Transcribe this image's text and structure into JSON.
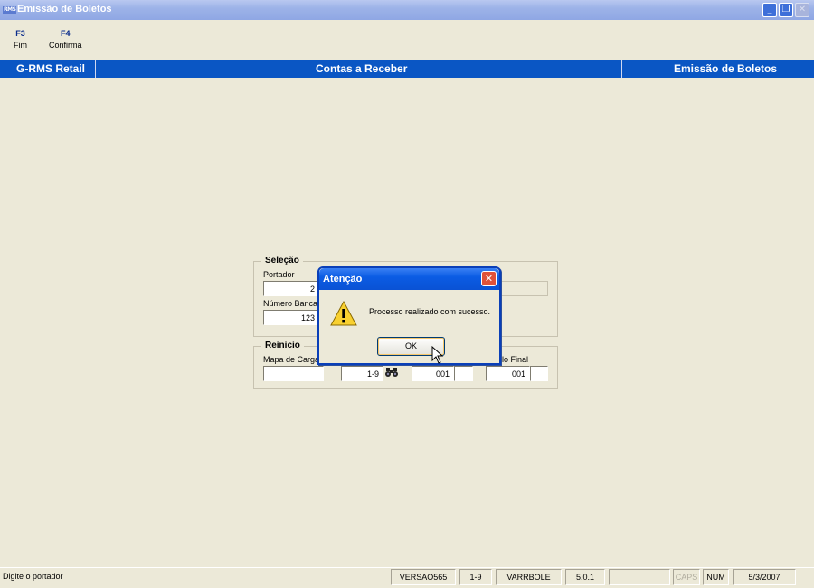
{
  "window": {
    "app_icon_text": "RMS",
    "title": "Emissão de Boletos",
    "icons": [
      "minimize-icon",
      "restore-icon",
      "close-icon"
    ]
  },
  "toolbar": {
    "items": [
      {
        "key": "F3",
        "label": "Fim"
      },
      {
        "key": "F4",
        "label": "Confirma"
      }
    ]
  },
  "header": {
    "system": "G-RMS Retail",
    "module": "Contas a Receber",
    "screen": "Emissão de Boletos",
    "color": "#0a56c4"
  },
  "selecao": {
    "title": "Seleção",
    "portador_label": "Portador",
    "portador_value": "2",
    "numero_bancario_label": "Número Banca",
    "numero_bancario_value": "123"
  },
  "reinicio": {
    "title": "Reinicio",
    "mapa_carga_label": "Mapa de Carga",
    "mapa_carga_value": "",
    "field2_value": "1-9",
    "field3_value": "001",
    "final_label": "lo Final",
    "final_value": "001"
  },
  "dialog": {
    "title": "Atenção",
    "message": "Processo realizado com sucesso.",
    "ok_label": "OK",
    "icon": "warning-icon"
  },
  "status": {
    "message": "Digite o portador",
    "version": "VERSAO565",
    "code": "1-9",
    "program": "VARRBOLE",
    "release": "5.0.1",
    "empty": "",
    "caps": "CAPS",
    "num": "NUM",
    "date": "5/3/2007"
  }
}
